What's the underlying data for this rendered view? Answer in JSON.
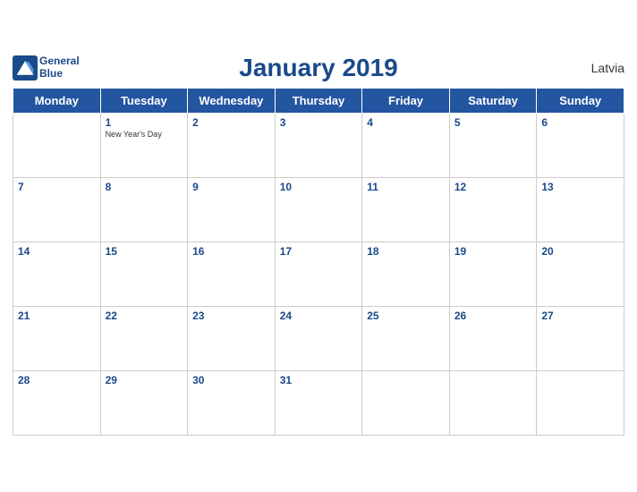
{
  "brand": {
    "name_line1": "General",
    "name_line2": "Blue"
  },
  "title": "January 2019",
  "country": "Latvia",
  "days_of_week": [
    "Monday",
    "Tuesday",
    "Wednesday",
    "Thursday",
    "Friday",
    "Saturday",
    "Sunday"
  ],
  "weeks": [
    [
      {
        "day": null,
        "holiday": null
      },
      {
        "day": "1",
        "holiday": "New Year's Day"
      },
      {
        "day": "2",
        "holiday": null
      },
      {
        "day": "3",
        "holiday": null
      },
      {
        "day": "4",
        "holiday": null
      },
      {
        "day": "5",
        "holiday": null
      },
      {
        "day": "6",
        "holiday": null
      }
    ],
    [
      {
        "day": "7",
        "holiday": null
      },
      {
        "day": "8",
        "holiday": null
      },
      {
        "day": "9",
        "holiday": null
      },
      {
        "day": "10",
        "holiday": null
      },
      {
        "day": "11",
        "holiday": null
      },
      {
        "day": "12",
        "holiday": null
      },
      {
        "day": "13",
        "holiday": null
      }
    ],
    [
      {
        "day": "14",
        "holiday": null
      },
      {
        "day": "15",
        "holiday": null
      },
      {
        "day": "16",
        "holiday": null
      },
      {
        "day": "17",
        "holiday": null
      },
      {
        "day": "18",
        "holiday": null
      },
      {
        "day": "19",
        "holiday": null
      },
      {
        "day": "20",
        "holiday": null
      }
    ],
    [
      {
        "day": "21",
        "holiday": null
      },
      {
        "day": "22",
        "holiday": null
      },
      {
        "day": "23",
        "holiday": null
      },
      {
        "day": "24",
        "holiday": null
      },
      {
        "day": "25",
        "holiday": null
      },
      {
        "day": "26",
        "holiday": null
      },
      {
        "day": "27",
        "holiday": null
      }
    ],
    [
      {
        "day": "28",
        "holiday": null
      },
      {
        "day": "29",
        "holiday": null
      },
      {
        "day": "30",
        "holiday": null
      },
      {
        "day": "31",
        "holiday": null
      },
      {
        "day": null,
        "holiday": null
      },
      {
        "day": null,
        "holiday": null
      },
      {
        "day": null,
        "holiday": null
      }
    ]
  ]
}
